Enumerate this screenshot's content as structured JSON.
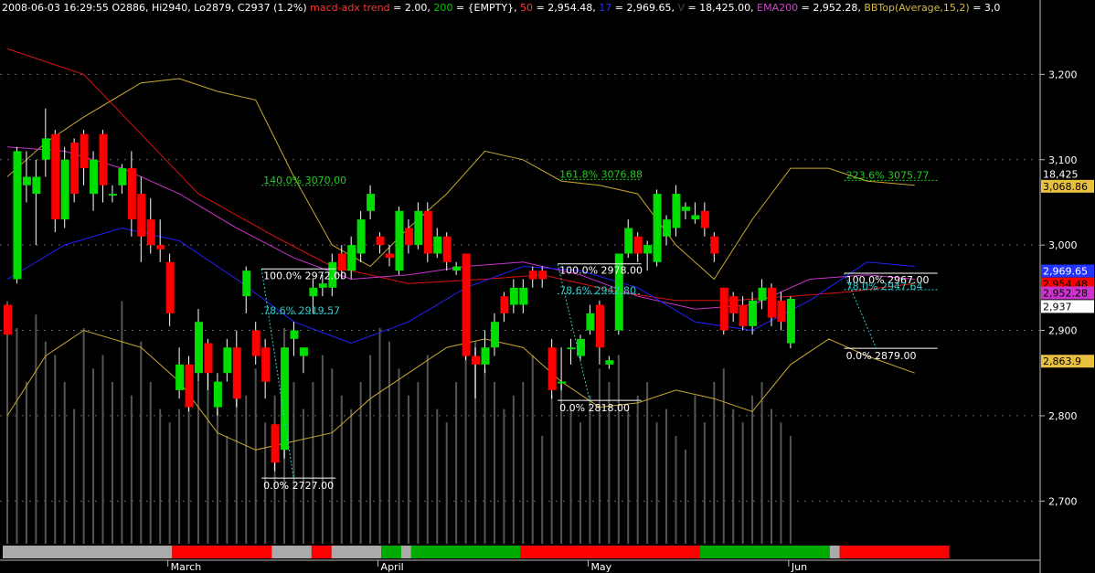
{
  "header": {
    "segments": [
      {
        "text": "2008-06-03 16:29:55 O2886, Hi2940, Lo2879, C2937 (1.2%)",
        "color": "#ffffff"
      },
      {
        "text": " macd-adx trend",
        "color": "#ff3333"
      },
      {
        "text": " = 2.00, ",
        "color": "#ffffff"
      },
      {
        "text": "200",
        "color": "#00cc00"
      },
      {
        "text": " = {EMPTY}, ",
        "color": "#ffffff"
      },
      {
        "text": "50",
        "color": "#ff3333"
      },
      {
        "text": " = 2,954.48, ",
        "color": "#ffffff"
      },
      {
        "text": "17",
        "color": "#2233ff"
      },
      {
        "text": " = 2,969.65, ",
        "color": "#ffffff"
      },
      {
        "text": "V",
        "color": "#444444"
      },
      {
        "text": " = 18,425.00, ",
        "color": "#ffffff"
      },
      {
        "text": "EMA200",
        "color": "#cc44cc"
      },
      {
        "text": " = 2,952.28, ",
        "color": "#ffffff"
      },
      {
        "text": "BBTop(Average,15,2)",
        "color": "#d4b84a"
      },
      {
        "text": " = 3,0",
        "color": "#ffffff"
      }
    ]
  },
  "colors": {
    "up": "#00dd00",
    "down": "#ff0000",
    "ma50": "#dd1111",
    "ma17": "#2222ff",
    "ema200": "#cc33cc",
    "bb": "#c8a830",
    "volume": "#555555",
    "fib": "#ffffff",
    "fib_ext": "#22cc22"
  },
  "chart_data": {
    "type": "candlestick",
    "ylim": [
      2650,
      3270
    ],
    "yticks": [
      2700,
      2800,
      2900,
      3000,
      3100,
      3200
    ],
    "ytick_labels": [
      "2,700",
      "2,800",
      "2,900",
      "3,000",
      "3,100",
      "3,200"
    ],
    "xlabels": [
      {
        "label": "March",
        "bar": 17
      },
      {
        "label": "April",
        "bar": 39
      },
      {
        "label": "May",
        "bar": 61
      },
      {
        "label": "Jun",
        "bar": 82
      }
    ],
    "candles": [
      [
        2930,
        2895,
        2930,
        2895
      ],
      [
        2960,
        3110,
        3115,
        2955
      ],
      [
        3070,
        3080,
        3110,
        3050
      ],
      [
        3060,
        3080,
        3100,
        3000
      ],
      [
        3100,
        3125,
        3160,
        3080
      ],
      [
        3130,
        3030,
        3135,
        3015
      ],
      [
        3030,
        3100,
        3115,
        3020
      ],
      [
        3120,
        3060,
        3125,
        3050
      ],
      [
        3130,
        3090,
        3135,
        3070
      ],
      [
        3060,
        3100,
        3110,
        3040
      ],
      [
        3130,
        3070,
        3135,
        3050
      ],
      [
        3060,
        3060,
        3070,
        3050
      ],
      [
        3070,
        3090,
        3095,
        3060
      ],
      [
        3090,
        3030,
        3110,
        3010
      ],
      [
        3060,
        3010,
        3080,
        2980
      ],
      [
        3030,
        3000,
        3055,
        2990
      ],
      [
        3000,
        2995,
        3030,
        2980
      ],
      [
        2980,
        2920,
        2990,
        2905
      ],
      [
        2830,
        2860,
        2880,
        2820
      ],
      [
        2860,
        2810,
        2870,
        2805
      ],
      [
        2850,
        2910,
        2925,
        2840
      ],
      [
        2885,
        2850,
        2890,
        2830
      ],
      [
        2810,
        2840,
        2850,
        2800
      ],
      [
        2850,
        2880,
        2890,
        2840
      ],
      [
        2880,
        2820,
        2900,
        2810
      ],
      [
        2940,
        2970,
        2975,
        2920
      ],
      [
        2900,
        2870,
        2910,
        2860
      ],
      [
        2880,
        2840,
        2890,
        2820
      ],
      [
        2790,
        2745,
        2790,
        2735
      ],
      [
        2760,
        2880,
        2880,
        2750
      ],
      [
        2890,
        2900,
        2910,
        2870
      ],
      [
        2870,
        2880,
        2880,
        2850
      ],
      [
        2940,
        2950,
        2960,
        2920
      ],
      [
        2950,
        2955,
        2965,
        2940
      ],
      [
        2950,
        2980,
        2990,
        2940
      ],
      [
        2990,
        2970,
        3000,
        2960
      ],
      [
        2970,
        3000,
        3010,
        2960
      ],
      [
        2990,
        3030,
        3040,
        2980
      ],
      [
        3040,
        3060,
        3070,
        3030
      ],
      [
        3010,
        3000,
        3015,
        2990
      ],
      [
        2990,
        2985,
        3000,
        2975
      ],
      [
        2970,
        3040,
        3045,
        2965
      ],
      [
        3020,
        3000,
        3030,
        2990
      ],
      [
        3000,
        3040,
        3050,
        2995
      ],
      [
        3040,
        2990,
        3050,
        2980
      ],
      [
        2990,
        3010,
        3020,
        2985
      ],
      [
        3010,
        2980,
        3015,
        2970
      ],
      [
        2970,
        2975,
        2980,
        2965
      ],
      [
        2990,
        2870,
        2990,
        2865
      ],
      [
        2870,
        2860,
        2880,
        2820
      ],
      [
        2860,
        2880,
        2900,
        2850
      ],
      [
        2880,
        2910,
        2920,
        2870
      ],
      [
        2940,
        2920,
        2945,
        2910
      ],
      [
        2930,
        2950,
        2960,
        2920
      ],
      [
        2930,
        2950,
        2960,
        2920
      ],
      [
        2970,
        2960,
        2975,
        2950
      ],
      [
        2970,
        2960,
        2975,
        2950
      ],
      [
        2880,
        2830,
        2890,
        2820
      ],
      [
        2840,
        2840,
        2880,
        2830
      ],
      [
        2880,
        2880,
        2890,
        2860
      ],
      [
        2870,
        2890,
        2895,
        2865
      ],
      [
        2900,
        2920,
        2930,
        2895
      ],
      [
        2930,
        2880,
        2935,
        2860
      ],
      [
        2860,
        2865,
        2870,
        2855
      ],
      [
        2900,
        2990,
        2990,
        2895
      ],
      [
        2990,
        3020,
        3030,
        2985
      ],
      [
        3010,
        2990,
        3015,
        2980
      ],
      [
        2990,
        3000,
        3005,
        2970
      ],
      [
        2980,
        3060,
        3065,
        2975
      ],
      [
        3010,
        3030,
        3035,
        3000
      ],
      [
        3020,
        3060,
        3070,
        3010
      ],
      [
        3040,
        3045,
        3050,
        3030
      ],
      [
        3030,
        3035,
        3050,
        3025
      ],
      [
        3040,
        3020,
        3050,
        3010
      ],
      [
        3010,
        2990,
        3015,
        2980
      ],
      [
        2950,
        2900,
        2950,
        2895
      ],
      [
        2940,
        2920,
        2945,
        2910
      ],
      [
        2930,
        2905,
        2940,
        2900
      ],
      [
        2905,
        2935,
        2945,
        2895
      ],
      [
        2935,
        2950,
        2960,
        2925
      ],
      [
        2950,
        2915,
        2955,
        2905
      ],
      [
        2935,
        2910,
        2945,
        2900
      ],
      [
        2885,
        2937,
        2940,
        2879
      ]
    ],
    "volume_ratio": [
      0.9,
      0.8,
      0.6,
      0.85,
      0.75,
      0.7,
      0.6,
      0.5,
      0.8,
      0.65,
      0.7,
      0.6,
      0.9,
      0.55,
      0.75,
      0.6,
      0.5,
      0.45,
      0.5,
      0.55,
      0.6,
      0.65,
      0.5,
      0.4,
      0.6,
      0.55,
      0.65,
      0.45,
      0.55,
      0.8,
      0.6,
      0.5,
      0.6,
      0.7,
      0.65,
      0.55,
      0.5,
      0.6,
      0.7,
      0.8,
      0.75,
      0.65,
      0.55,
      0.6,
      0.7,
      0.5,
      0.45,
      0.6,
      0.9,
      0.75,
      0.65,
      0.6,
      0.5,
      0.55,
      0.6,
      0.7,
      0.4,
      0.55,
      0.6,
      0.5,
      0.45,
      0.55,
      0.65,
      0.6,
      0.7,
      0.5,
      0.55,
      0.6,
      0.45,
      0.5,
      0.4,
      0.35,
      0.55,
      0.45,
      0.6,
      0.65,
      0.5,
      0.45,
      0.55,
      0.6,
      0.5,
      0.45,
      0.4
    ],
    "trend_bar": [
      {
        "from": 0,
        "to": 17,
        "color": "#aaaaaa"
      },
      {
        "from": 17,
        "to": 27,
        "color": "#ff0000"
      },
      {
        "from": 27,
        "to": 31,
        "color": "#aaaaaa"
      },
      {
        "from": 31,
        "to": 33,
        "color": "#ff0000"
      },
      {
        "from": 33,
        "to": 38,
        "color": "#aaaaaa"
      },
      {
        "from": 38,
        "to": 40,
        "color": "#00aa00"
      },
      {
        "from": 40,
        "to": 41,
        "color": "#aaaaaa"
      },
      {
        "from": 41,
        "to": 52,
        "color": "#00aa00"
      },
      {
        "from": 52,
        "to": 70,
        "color": "#ff0000"
      },
      {
        "from": 70,
        "to": 83,
        "color": "#00aa00"
      },
      {
        "from": 83,
        "to": 84,
        "color": "#aaaaaa"
      },
      {
        "from": 84,
        "to": 95,
        "color": "#ff0000"
      }
    ],
    "ma50": [
      [
        0,
        3230
      ],
      [
        8,
        3200
      ],
      [
        14,
        3130
      ],
      [
        20,
        3060
      ],
      [
        28,
        3010
      ],
      [
        34,
        2975
      ],
      [
        42,
        2955
      ],
      [
        50,
        2960
      ],
      [
        56,
        2965
      ],
      [
        64,
        2945
      ],
      [
        70,
        2935
      ],
      [
        76,
        2935
      ],
      [
        82,
        2940
      ],
      [
        88,
        2945
      ],
      [
        95,
        2955
      ]
    ],
    "ma17": [
      [
        0,
        2960
      ],
      [
        6,
        3000
      ],
      [
        12,
        3020
      ],
      [
        18,
        3005
      ],
      [
        24,
        2960
      ],
      [
        30,
        2910
      ],
      [
        36,
        2885
      ],
      [
        42,
        2910
      ],
      [
        48,
        2950
      ],
      [
        54,
        2975
      ],
      [
        60,
        2970
      ],
      [
        66,
        2950
      ],
      [
        72,
        2910
      ],
      [
        78,
        2900
      ],
      [
        84,
        2935
      ],
      [
        90,
        2980
      ],
      [
        95,
        2975
      ]
    ],
    "ema200": [
      [
        0,
        3115
      ],
      [
        6,
        3110
      ],
      [
        12,
        3090
      ],
      [
        18,
        3060
      ],
      [
        24,
        3020
      ],
      [
        30,
        2985
      ],
      [
        36,
        2960
      ],
      [
        42,
        2965
      ],
      [
        48,
        2975
      ],
      [
        54,
        2980
      ],
      [
        60,
        2965
      ],
      [
        66,
        2940
      ],
      [
        72,
        2925
      ],
      [
        78,
        2930
      ],
      [
        84,
        2960
      ],
      [
        90,
        2965
      ],
      [
        95,
        2960
      ]
    ],
    "bb_top": [
      [
        0,
        3080
      ],
      [
        4,
        3120
      ],
      [
        8,
        3150
      ],
      [
        14,
        3190
      ],
      [
        18,
        3195
      ],
      [
        22,
        3180
      ],
      [
        26,
        3170
      ],
      [
        30,
        3080
      ],
      [
        34,
        3000
      ],
      [
        38,
        2975
      ],
      [
        42,
        3020
      ],
      [
        46,
        3060
      ],
      [
        50,
        3110
      ],
      [
        54,
        3100
      ],
      [
        58,
        3075
      ],
      [
        62,
        3070
      ],
      [
        66,
        3060
      ],
      [
        70,
        3000
      ],
      [
        74,
        2960
      ],
      [
        78,
        3030
      ],
      [
        82,
        3090
      ],
      [
        86,
        3090
      ],
      [
        90,
        3075
      ],
      [
        95,
        3070
      ]
    ],
    "bb_bottom": [
      [
        0,
        2800
      ],
      [
        4,
        2870
      ],
      [
        8,
        2900
      ],
      [
        14,
        2880
      ],
      [
        18,
        2840
      ],
      [
        22,
        2780
      ],
      [
        26,
        2760
      ],
      [
        30,
        2770
      ],
      [
        34,
        2780
      ],
      [
        38,
        2820
      ],
      [
        42,
        2850
      ],
      [
        46,
        2880
      ],
      [
        50,
        2890
      ],
      [
        54,
        2880
      ],
      [
        58,
        2840
      ],
      [
        62,
        2810
      ],
      [
        66,
        2815
      ],
      [
        70,
        2830
      ],
      [
        74,
        2820
      ],
      [
        78,
        2805
      ],
      [
        82,
        2860
      ],
      [
        86,
        2890
      ],
      [
        90,
        2870
      ],
      [
        95,
        2850
      ]
    ],
    "fibs": [
      {
        "bar_from": 27,
        "bar_to": 34,
        "top": 2972,
        "bottom": 2727,
        "top_label": "100.0%",
        "top_value": "2972.00",
        "bottom_label": "0.0%",
        "bottom_value": "2727.00",
        "mid_label": "78.6%",
        "mid_value": "2919.57",
        "mid_price": 2919.57,
        "ext_label": "140.0%",
        "ext_value": "3070.00",
        "ext_price": 3070
      },
      {
        "bar_from": 58,
        "bar_to": 66,
        "top": 2978,
        "bottom": 2818,
        "top_label": "100.0%",
        "top_value": "2978.00",
        "bottom_label": "0.0%",
        "bottom_value": "2818.00",
        "mid_label": "78.6%",
        "mid_value": "2942.80",
        "mid_price": 2942.8,
        "ext_label": "161.8%",
        "ext_value": "3076.88",
        "ext_price": 3076.88
      },
      {
        "bar_from": 88,
        "bar_to": 97,
        "top": 2967,
        "bottom": 2879,
        "top_label": "100.0%",
        "top_value": "2967.00",
        "bottom_label": "0.0%",
        "bottom_value": "2879.00",
        "mid_label": "78.0%",
        "mid_value": "2947.64",
        "mid_price": 2947.64,
        "ext_label": "223.6%",
        "ext_value": "3075.77",
        "ext_price": 3075.77
      }
    ],
    "right_labels": [
      {
        "text": "18,425",
        "price": 3083,
        "bg": "#000000",
        "fg": "#ffffff"
      },
      {
        "text": "3,068.86",
        "price": 3068.86,
        "bg": "#e8c040",
        "fg": "#000000"
      },
      {
        "text": "2,969.65",
        "price": 2969.65,
        "bg": "#2233ff",
        "fg": "#ffffff"
      },
      {
        "text": "2,954.48",
        "price": 2954.48,
        "bg": "#ff0000",
        "fg": "#000000"
      },
      {
        "text": "2,952.28",
        "price": 2944,
        "bg": "#cc33cc",
        "fg": "#000000"
      },
      {
        "text": "2,937",
        "price": 2928,
        "bg": "#ffffff",
        "fg": "#000000"
      },
      {
        "text": "2,863.9",
        "price": 2863.9,
        "bg": "#e8c040",
        "fg": "#000000"
      }
    ]
  }
}
